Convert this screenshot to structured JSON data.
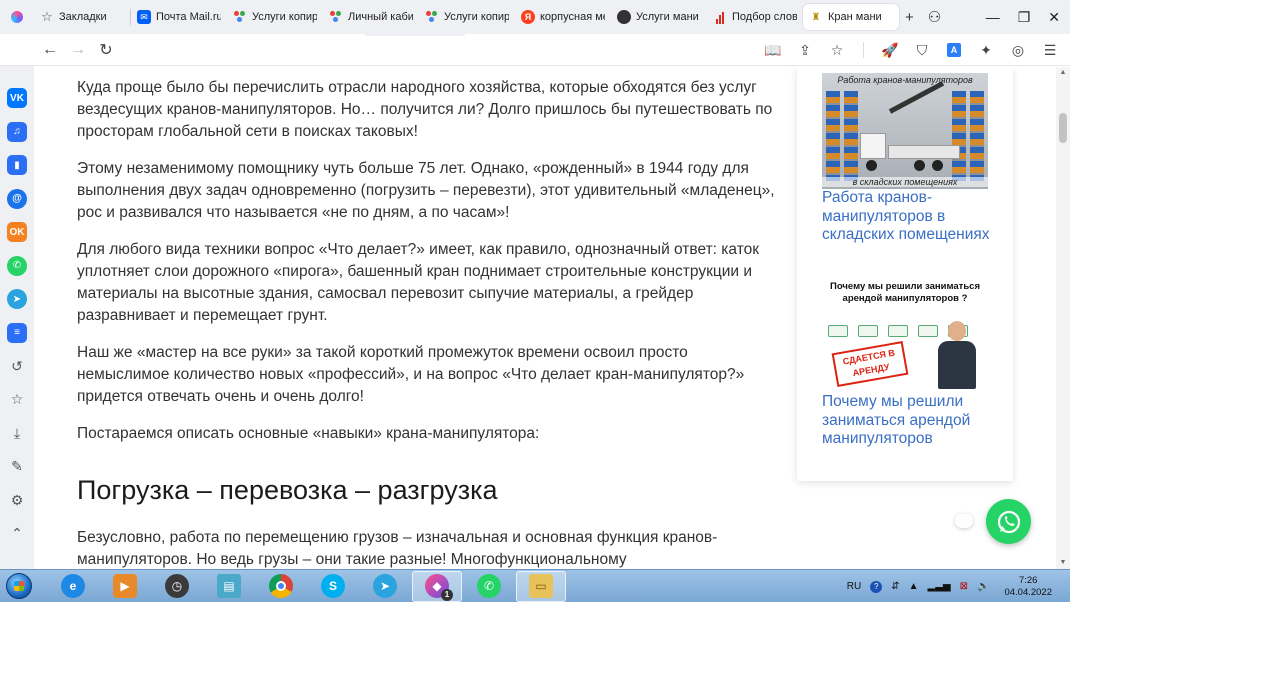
{
  "browser": {
    "tabs": [
      {
        "label": "Закладки",
        "icon": "star-icon"
      },
      {
        "label": "Почта Mail.ru",
        "icon": "mail-icon"
      },
      {
        "label": "Услуги копир",
        "icon": "dots-icon"
      },
      {
        "label": "Личный каби",
        "icon": "dots-icon"
      },
      {
        "label": "Услуги копир",
        "icon": "dots-icon"
      },
      {
        "label": "корпусная ме",
        "icon": "yandex-icon"
      },
      {
        "label": "Услуги мани",
        "icon": "dark-circle-icon"
      },
      {
        "label": "Подбор слов",
        "icon": "bar-chart-icon"
      },
      {
        "label": "Кран мани",
        "icon": "crane-icon",
        "active": true
      }
    ],
    "tab_actions": {
      "new_tab": "+",
      "incognito": "⚇"
    },
    "window_controls": {
      "minimize": "—",
      "restore": "❐",
      "close": "✕"
    },
    "nav": {
      "back": "←",
      "forward": "→",
      "reload": "↻"
    },
    "toolbar": {
      "reader": "📖",
      "share": "⇪",
      "bookmark": "☆",
      "rocket": "🚀",
      "shield": "⛉",
      "translate": "A",
      "extensions": "✦",
      "account": "◎",
      "menu": "☰"
    }
  },
  "sidebar": {
    "items": [
      {
        "name": "vk",
        "label": "VK",
        "color": "#0077ff"
      },
      {
        "name": "music",
        "label": "♫",
        "color": "#2b6ff6"
      },
      {
        "name": "stats",
        "label": "▮",
        "color": "#2b6ff6"
      },
      {
        "name": "mail-at",
        "label": "@",
        "color": "#1a73e8"
      },
      {
        "name": "odnoklassniki",
        "label": "OK",
        "color": "#f58220"
      },
      {
        "name": "whatsapp",
        "label": "✆",
        "color": "#25d366"
      },
      {
        "name": "telegram",
        "label": "➤",
        "color": "#2aa3df"
      },
      {
        "name": "list",
        "label": "≡",
        "color": "#2b6ff6"
      }
    ],
    "tools": [
      {
        "name": "history",
        "label": "↺"
      },
      {
        "name": "favorites",
        "label": "☆"
      },
      {
        "name": "downloads",
        "label": "⤓"
      },
      {
        "name": "pen",
        "label": "✎"
      },
      {
        "name": "settings",
        "label": "⚙"
      },
      {
        "name": "collapse",
        "label": "⌃"
      }
    ]
  },
  "article": {
    "p1": "Куда проще было бы перечислить отрасли народного хозяйства, которые обходятся без услуг вездесущих кранов-манипуляторов. Но… получится ли? Долго пришлось бы путешествовать по просторам глобальной сети в поисках таковых!",
    "p2": "Этому незаменимому помощнику чуть больше 75 лет. Однако, «рожденный» в 1944 году для выполнения двух задач одновременно (погрузить – перевезти), этот удивительный «младенец», рос и развивался что называется «не по дням, а по часам»!",
    "p3": "Для любого вида техники вопрос «Что делает?» имеет, как правило, однозначный ответ: каток уплотняет слои дорожного «пирога», башенный кран поднимает строительные конструкции и материалы на высотные здания, самосвал перевозит сыпучие материалы, а грейдер разравнивает и перемещает грунт.",
    "p4": "Наш же «мастер на все руки» за такой короткий промежуток времени освоил просто немыслимое количество новых «профессий», и на вопрос «Что делает кран-манипулятор?» придется отвечать очень и очень долго!",
    "p5": "Постараемся описать основные «навыки» крана-манипулятора:",
    "h2": "Погрузка – перевозка – разгрузка",
    "p6": "Безусловно, работа по перемещению грузов – изначальная и основная функция кранов-манипуляторов. Но ведь грузы – они такие разные! Многофункциональному"
  },
  "widget": {
    "card1": {
      "image_caption_top": "Работа кранов-манипуляторов",
      "image_caption_bottom": "в складских помещениях",
      "link": "Работа кранов-манипуляторов в складских помещениях"
    },
    "card2": {
      "image_caption": "Почему мы решили заниматься арендой манипуляторов ?",
      "stamp": "СДАЕТСЯ В АРЕНДУ",
      "link": "Почему мы решили заниматься арендой манипуляторов"
    }
  },
  "taskbar": {
    "apps": [
      {
        "name": "internet-explorer",
        "label": "e",
        "color": "#1e88e5"
      },
      {
        "name": "media-player",
        "label": "▶",
        "color": "#e8892a"
      },
      {
        "name": "clock-app",
        "label": "◷",
        "color": "#3a3a3a"
      },
      {
        "name": "notepad",
        "label": "▤",
        "color": "#4aa8c8"
      },
      {
        "name": "chrome",
        "label": "◉",
        "color": "#db4437"
      },
      {
        "name": "skype",
        "label": "S",
        "color": "#00aff0"
      },
      {
        "name": "telegram",
        "label": "➤",
        "color": "#2aa3df"
      },
      {
        "name": "browser",
        "label": "◆",
        "color": "#6b4ce6",
        "badge": "1",
        "active": true
      },
      {
        "name": "whatsapp",
        "label": "✆",
        "color": "#25d366"
      },
      {
        "name": "file-explorer",
        "label": "▭",
        "color": "#e7c25a",
        "active": true
      }
    ],
    "tray": {
      "lang": "RU",
      "help": "?",
      "time": "7:26",
      "date": "04.04.2022"
    }
  }
}
